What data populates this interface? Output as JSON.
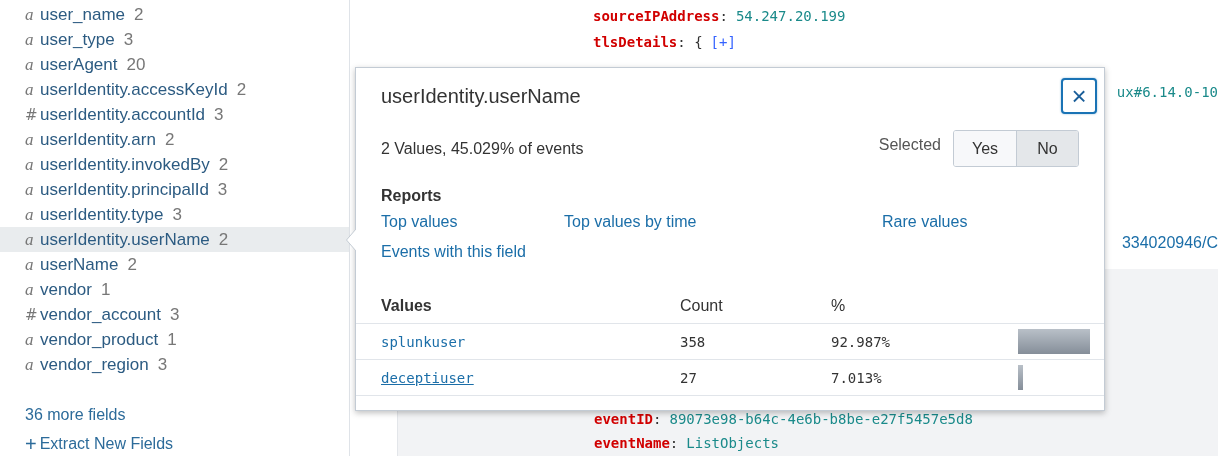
{
  "sidebar": {
    "fields": [
      {
        "type": "a",
        "name": "user_name",
        "count": "2",
        "selected": false
      },
      {
        "type": "a",
        "name": "user_type",
        "count": "3",
        "selected": false
      },
      {
        "type": "a",
        "name": "userAgent",
        "count": "20",
        "selected": false
      },
      {
        "type": "a",
        "name": "userIdentity.accessKeyId",
        "count": "2",
        "selected": false
      },
      {
        "type": "#",
        "name": "userIdentity.accountId",
        "count": "3",
        "selected": false
      },
      {
        "type": "a",
        "name": "userIdentity.arn",
        "count": "2",
        "selected": false
      },
      {
        "type": "a",
        "name": "userIdentity.invokedBy",
        "count": "2",
        "selected": false
      },
      {
        "type": "a",
        "name": "userIdentity.principalId",
        "count": "3",
        "selected": false
      },
      {
        "type": "a",
        "name": "userIdentity.type",
        "count": "3",
        "selected": false
      },
      {
        "type": "a",
        "name": "userIdentity.userName",
        "count": "2",
        "selected": true
      },
      {
        "type": "a",
        "name": "userName",
        "count": "2",
        "selected": false
      },
      {
        "type": "a",
        "name": "vendor",
        "count": "1",
        "selected": false
      },
      {
        "type": "#",
        "name": "vendor_account",
        "count": "3",
        "selected": false
      },
      {
        "type": "a",
        "name": "vendor_product",
        "count": "1",
        "selected": false
      },
      {
        "type": "a",
        "name": "vendor_region",
        "count": "3",
        "selected": false
      }
    ],
    "more_fields": "36 more fields",
    "extract_icon": "+",
    "extract_link": "Extract New Fields"
  },
  "event": {
    "top_lines": [
      {
        "key": "sourceIPAddress",
        "sep": ":",
        "value": "54.247.20.199"
      },
      {
        "key": "tlsDetails",
        "sep": ": {",
        "expand": "[+]"
      }
    ],
    "fragment_1": "ux#6.14.0-10",
    "fragment_2": "334020946/C",
    "bottom_lines": [
      {
        "key": "eventID",
        "sep": ":",
        "value": "89073e98-b64c-4e6b-b8be-e27f5457e5d8"
      },
      {
        "key": "eventName",
        "sep": ":",
        "value": "ListObjects"
      }
    ]
  },
  "popup": {
    "title": "userIdentity.userName",
    "summary": "2 Values, 45.029% of events",
    "selected_label": "Selected",
    "toggle": [
      {
        "label": "Yes",
        "selected": false
      },
      {
        "label": "No",
        "selected": true
      }
    ],
    "close_icon": "×",
    "reports_heading": "Reports",
    "reports": [
      "Top values",
      "Top values by time",
      "Rare values",
      "Events with this field"
    ],
    "columns": [
      "Values",
      "Count",
      "%"
    ],
    "rows": [
      {
        "value": "splunkuser",
        "count": "358",
        "percent": "92.987%",
        "level": 0.92987,
        "hovered": false
      },
      {
        "value": "deceptiuser",
        "count": "27",
        "percent": "7.013%",
        "level": 0.07013,
        "hovered": true
      }
    ]
  }
}
